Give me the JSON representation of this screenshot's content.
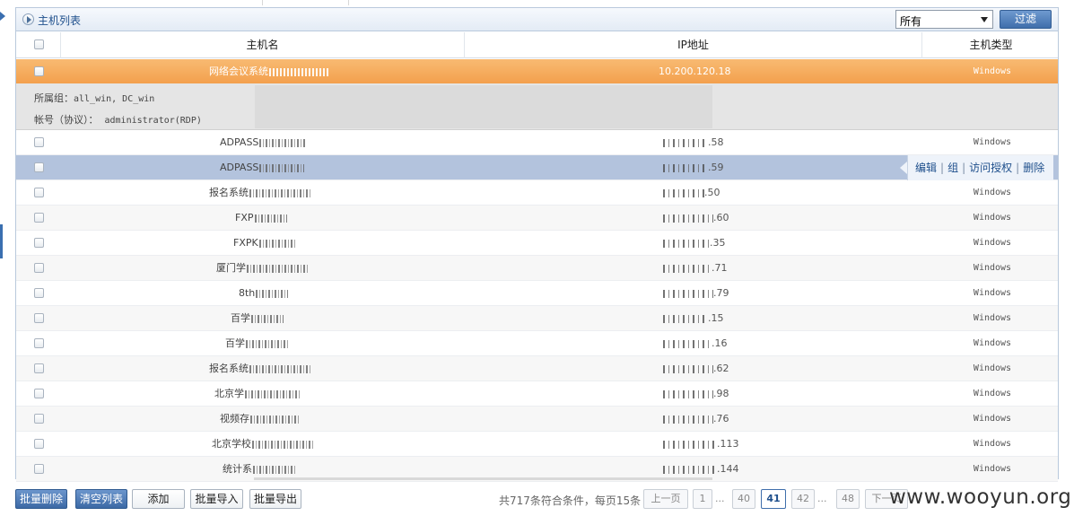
{
  "panel": {
    "title": "主机列表"
  },
  "filter": {
    "selected": "所有",
    "button": "过滤"
  },
  "columns": {
    "name": "主机名",
    "ip": "IP地址",
    "type": "主机类型"
  },
  "expanded_row": {
    "name": "网络会议系统",
    "ip": "10.200.120.18",
    "type": "Windows",
    "group_label": "所属组：",
    "group_value": "all_win, DC_win",
    "account_label": "帐号（协议）：",
    "account_value": "administrator(RDP)"
  },
  "rows": [
    {
      "name": "ADPASS",
      "ip_tail": ".58",
      "type": "Windows"
    },
    {
      "name": "ADPASS",
      "ip_tail": ".59",
      "type": ""
    },
    {
      "name": "报名系统",
      "ip_tail": ".50",
      "type": "Windows"
    },
    {
      "name": "FXP",
      "ip_tail": ".60",
      "type": "Windows"
    },
    {
      "name": "FXPK",
      "ip_tail": ".35",
      "type": "Windows"
    },
    {
      "name": "厦门学",
      "ip_tail": ".71",
      "type": "Windows"
    },
    {
      "name": "8th",
      "ip_tail": ".79",
      "type": "Windows"
    },
    {
      "name": "百学",
      "ip_tail": ".15",
      "type": "Windows"
    },
    {
      "name": "百学",
      "ip_tail": ".16",
      "type": "Windows"
    },
    {
      "name": "报名系统",
      "ip_tail": ".62",
      "type": "Windows"
    },
    {
      "name": "北京学",
      "ip_tail": ".98",
      "type": "Windows"
    },
    {
      "name": "视频存",
      "ip_tail": ".76",
      "type": "Windows"
    },
    {
      "name": "北京学校",
      "ip_tail": ".113",
      "type": "Windows"
    },
    {
      "name": "统计系",
      "ip_tail": ".144",
      "type": "Windows"
    }
  ],
  "row_actions": {
    "edit": "编辑",
    "group": "组",
    "access": "访问授权",
    "delete": "删除"
  },
  "buttons": {
    "batch_delete": "批量删除",
    "clear_list": "清空列表",
    "add": "添加",
    "batch_import": "批量导入",
    "batch_export": "批量导出"
  },
  "pager": {
    "info": "共717条符合条件，每页15条",
    "prev": "上一页",
    "first": "1",
    "dots": "...",
    "p40": "40",
    "p41": "41",
    "p42": "42",
    "p48": "48",
    "next": "下一页"
  },
  "watermark": "www.wooyun.org"
}
